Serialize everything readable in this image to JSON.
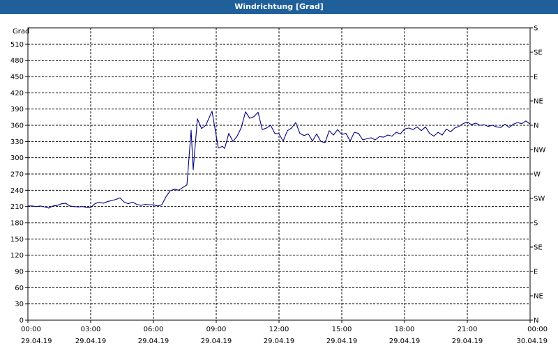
{
  "window": {
    "title": "Windrichtung [Grad]"
  },
  "colors": {
    "titlebar": "#1f5f9a",
    "line": "#000080",
    "grid": "#000000"
  },
  "chart_data": {
    "type": "line",
    "title": "Windrichtung [Grad]",
    "ylabel": "Grad",
    "ylim": [
      0,
      540
    ],
    "yticks": [
      0,
      30,
      60,
      90,
      120,
      150,
      180,
      210,
      240,
      270,
      300,
      330,
      360,
      390,
      420,
      450,
      480,
      510
    ],
    "right_ticks": [
      {
        "value": 0,
        "label": "N"
      },
      {
        "value": 45,
        "label": "NE"
      },
      {
        "value": 90,
        "label": "E"
      },
      {
        "value": 135,
        "label": "SE"
      },
      {
        "value": 180,
        "label": "S"
      },
      {
        "value": 225,
        "label": "SW"
      },
      {
        "value": 270,
        "label": "W"
      },
      {
        "value": 315,
        "label": "NW"
      },
      {
        "value": 360,
        "label": "N"
      },
      {
        "value": 405,
        "label": "NE"
      },
      {
        "value": 450,
        "label": "E"
      },
      {
        "value": 495,
        "label": "SE"
      },
      {
        "value": 540,
        "label": "S"
      }
    ],
    "xlim_hours": [
      0,
      24
    ],
    "xticks": [
      {
        "hour": 0,
        "time": "00:00",
        "date": "29.04.19"
      },
      {
        "hour": 3,
        "time": "03:00",
        "date": "29.04.19"
      },
      {
        "hour": 6,
        "time": "06:00",
        "date": "29.04.19"
      },
      {
        "hour": 9,
        "time": "09:00",
        "date": "29.04.19"
      },
      {
        "hour": 12,
        "time": "12:00",
        "date": "29.04.19"
      },
      {
        "hour": 15,
        "time": "15:00",
        "date": "29.04.19"
      },
      {
        "hour": 18,
        "time": "18:00",
        "date": "29.04.19"
      },
      {
        "hour": 21,
        "time": "21:00",
        "date": "29.04.19"
      },
      {
        "hour": 24,
        "time": "00:00",
        "date": "30.04.19"
      }
    ],
    "grid": true,
    "series": [
      {
        "values": [
          [
            0.0,
            211
          ],
          [
            0.2,
            211
          ],
          [
            0.4,
            210
          ],
          [
            0.6,
            211
          ],
          [
            0.8,
            209
          ],
          [
            1.0,
            207
          ],
          [
            1.2,
            211
          ],
          [
            1.4,
            212
          ],
          [
            1.6,
            215
          ],
          [
            1.8,
            216
          ],
          [
            2.0,
            211
          ],
          [
            2.2,
            210
          ],
          [
            2.4,
            209
          ],
          [
            2.6,
            210
          ],
          [
            2.8,
            208
          ],
          [
            3.0,
            208
          ],
          [
            3.2,
            215
          ],
          [
            3.4,
            218
          ],
          [
            3.6,
            216
          ],
          [
            3.8,
            219
          ],
          [
            4.0,
            221
          ],
          [
            4.2,
            223
          ],
          [
            4.4,
            226
          ],
          [
            4.6,
            218
          ],
          [
            4.8,
            215
          ],
          [
            5.0,
            218
          ],
          [
            5.2,
            214
          ],
          [
            5.4,
            212
          ],
          [
            5.6,
            214
          ],
          [
            5.8,
            213
          ],
          [
            6.0,
            213
          ],
          [
            6.2,
            211
          ],
          [
            6.4,
            213
          ],
          [
            6.6,
            228
          ],
          [
            6.8,
            239
          ],
          [
            7.0,
            242
          ],
          [
            7.2,
            240
          ],
          [
            7.4,
            245
          ],
          [
            7.6,
            250
          ],
          [
            7.8,
            351
          ],
          [
            7.9,
            278
          ],
          [
            8.1,
            372
          ],
          [
            8.3,
            354
          ],
          [
            8.5,
            360
          ],
          [
            8.8,
            386
          ],
          [
            9.1,
            318
          ],
          [
            9.3,
            321
          ],
          [
            9.4,
            317
          ],
          [
            9.6,
            345
          ],
          [
            9.8,
            330
          ],
          [
            10.0,
            340
          ],
          [
            10.2,
            356
          ],
          [
            10.4,
            385
          ],
          [
            10.6,
            373
          ],
          [
            10.8,
            376
          ],
          [
            11.0,
            384
          ],
          [
            11.2,
            352
          ],
          [
            11.4,
            355
          ],
          [
            11.6,
            360
          ],
          [
            11.8,
            345
          ],
          [
            12.0,
            344
          ],
          [
            12.2,
            331
          ],
          [
            12.4,
            350
          ],
          [
            12.6,
            355
          ],
          [
            12.8,
            365
          ],
          [
            13.0,
            345
          ],
          [
            13.2,
            341
          ],
          [
            13.4,
            344
          ],
          [
            13.6,
            331
          ],
          [
            13.8,
            344
          ],
          [
            14.0,
            330
          ],
          [
            14.2,
            328
          ],
          [
            14.4,
            350
          ],
          [
            14.6,
            342
          ],
          [
            14.8,
            352
          ],
          [
            15.0,
            343
          ],
          [
            15.2,
            345
          ],
          [
            15.4,
            331
          ],
          [
            15.6,
            347
          ],
          [
            15.8,
            345
          ],
          [
            16.0,
            333
          ],
          [
            16.2,
            335
          ],
          [
            16.4,
            337
          ],
          [
            16.6,
            333
          ],
          [
            16.8,
            339
          ],
          [
            17.0,
            338
          ],
          [
            17.2,
            342
          ],
          [
            17.4,
            340
          ],
          [
            17.6,
            347
          ],
          [
            17.8,
            344
          ],
          [
            18.0,
            353
          ],
          [
            18.2,
            355
          ],
          [
            18.4,
            352
          ],
          [
            18.6,
            357
          ],
          [
            18.8,
            350
          ],
          [
            19.0,
            357
          ],
          [
            19.2,
            345
          ],
          [
            19.4,
            340
          ],
          [
            19.6,
            347
          ],
          [
            19.8,
            342
          ],
          [
            20.0,
            353
          ],
          [
            20.2,
            348
          ],
          [
            20.4,
            355
          ],
          [
            20.6,
            358
          ],
          [
            20.8,
            363
          ],
          [
            21.0,
            366
          ],
          [
            21.2,
            361
          ],
          [
            21.4,
            364
          ],
          [
            21.6,
            360
          ],
          [
            21.8,
            361
          ],
          [
            22.0,
            358
          ],
          [
            22.2,
            360
          ],
          [
            22.4,
            357
          ],
          [
            22.6,
            356
          ],
          [
            22.8,
            362
          ],
          [
            23.0,
            356
          ],
          [
            23.2,
            362
          ],
          [
            23.4,
            365
          ],
          [
            23.6,
            363
          ],
          [
            23.8,
            368
          ],
          [
            24.0,
            362
          ]
        ]
      }
    ]
  }
}
